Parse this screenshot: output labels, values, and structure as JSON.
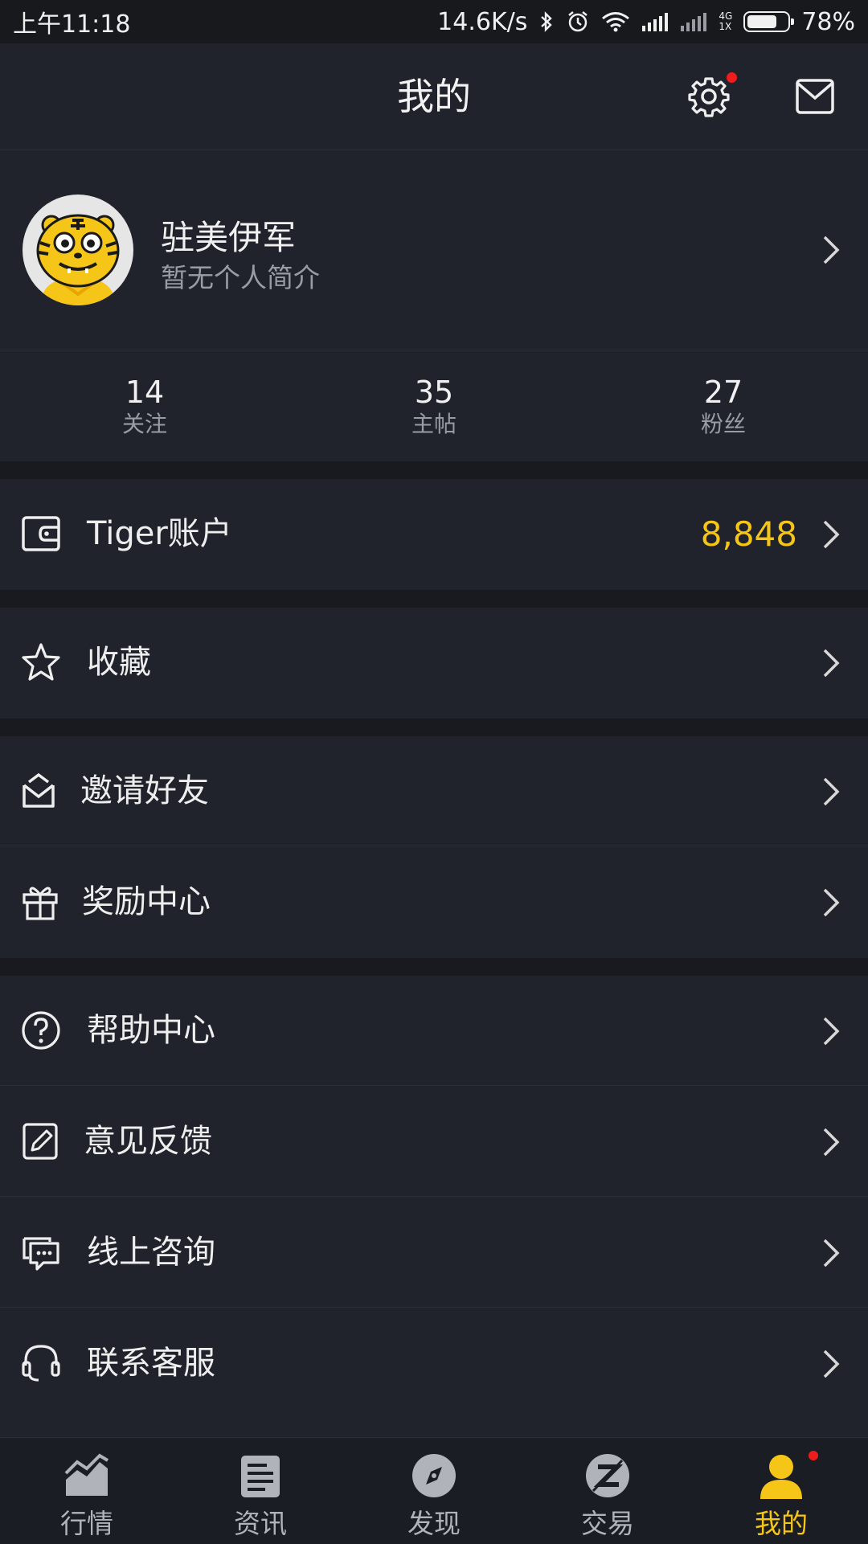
{
  "status_bar": {
    "time": "上午11:18",
    "net_speed": "14.6K/s",
    "network_label_top": "4G",
    "network_label_bottom": "1X",
    "battery": "78%",
    "battery_level": 0.78
  },
  "header": {
    "title": "我的",
    "settings_icon": "gear-icon",
    "messages_icon": "mail-icon",
    "notification_dot_color": "#ee1c1c"
  },
  "profile": {
    "name": "驻美伊军",
    "bio": "暂无个人简介",
    "avatar_icon": "tiger-avatar"
  },
  "stats": [
    {
      "value": "14",
      "label": "关注"
    },
    {
      "value": "35",
      "label": "主帖"
    },
    {
      "value": "27",
      "label": "粉丝"
    }
  ],
  "menu": {
    "account": {
      "label": "Tiger账户",
      "value": "8,848",
      "icon": "wallet-icon"
    },
    "favorites": {
      "label": "收藏",
      "icon": "star-icon"
    },
    "invite": {
      "label": "邀请好友",
      "icon": "envelope-icon"
    },
    "rewards": {
      "label": "奖励中心",
      "icon": "gift-icon"
    },
    "help": {
      "label": "帮助中心",
      "icon": "question-icon"
    },
    "feedback": {
      "label": "意见反馈",
      "icon": "edit-icon"
    },
    "online_consult": {
      "label": "线上咨询",
      "icon": "chat-icon"
    },
    "contact_service": {
      "label": "联系客服",
      "icon": "headset-icon"
    }
  },
  "tabbar": [
    {
      "label": "行情",
      "icon": "chart-icon",
      "active": false
    },
    {
      "label": "资讯",
      "icon": "news-icon",
      "active": false
    },
    {
      "label": "发现",
      "icon": "compass-icon",
      "active": false
    },
    {
      "label": "交易",
      "icon": "trade-icon",
      "active": false
    },
    {
      "label": "我的",
      "icon": "person-icon",
      "active": true
    }
  ],
  "colors": {
    "background": "#20232b",
    "section_gap": "#181a20",
    "accent": "#f5c518",
    "text_primary": "#eeeeee",
    "text_secondary": "#9a9ca3"
  }
}
